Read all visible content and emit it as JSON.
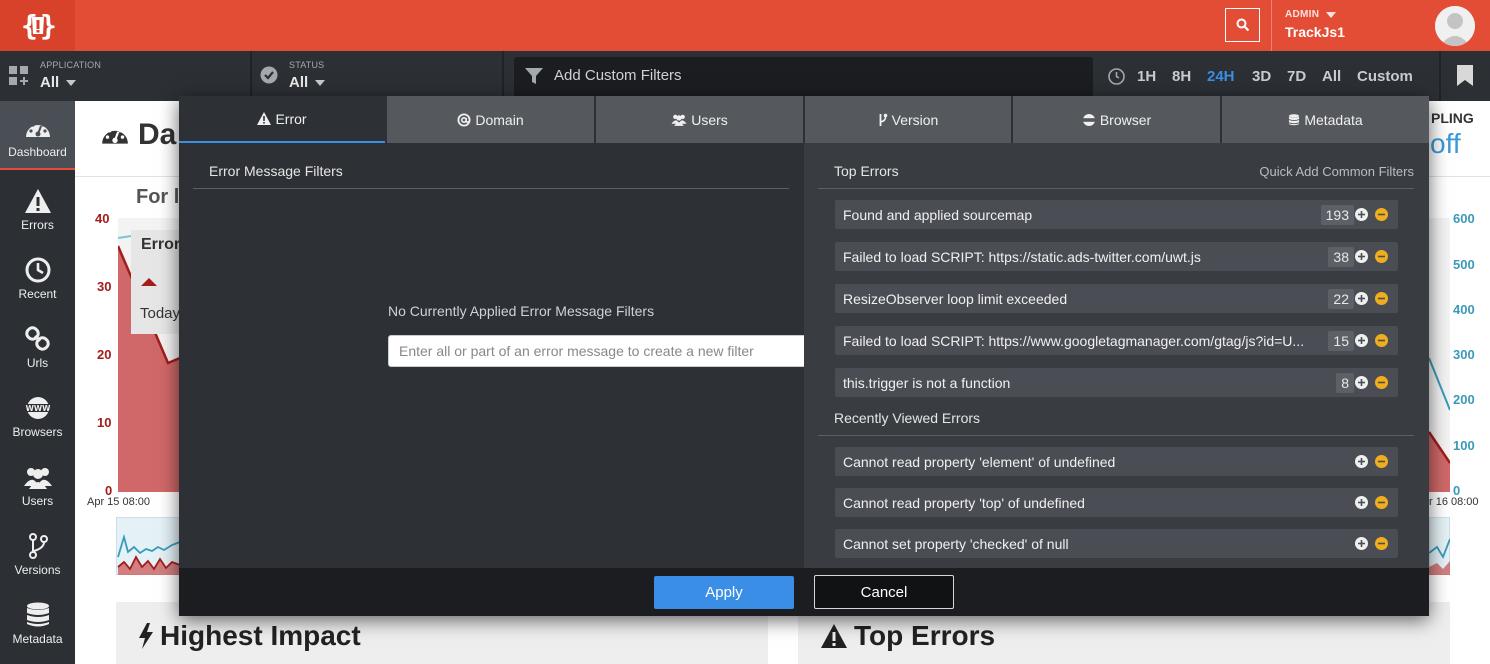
{
  "topbar": {
    "logo_text": "{!}",
    "admin_label": "ADMIN",
    "user_name": "TrackJs1"
  },
  "subbar": {
    "application_label": "APPLICATION",
    "application_value": "All",
    "status_label": "STATUS",
    "status_value": "All",
    "filter_text": "Add Custom Filters",
    "time_ranges": [
      "1H",
      "8H",
      "24H",
      "3D",
      "7D",
      "All",
      "Custom"
    ],
    "active_time_range": "24H"
  },
  "sidebar": {
    "items": [
      {
        "label": "Dashboard",
        "icon": "dashboard-gauge-icon"
      },
      {
        "label": "Errors",
        "icon": "warning-triangle-icon"
      },
      {
        "label": "Recent",
        "icon": "clock-icon"
      },
      {
        "label": "Urls",
        "icon": "link-icon"
      },
      {
        "label": "Browsers",
        "icon": "globe-www-icon"
      },
      {
        "label": "Users",
        "icon": "users-icon"
      },
      {
        "label": "Versions",
        "icon": "branch-icon"
      },
      {
        "label": "Metadata",
        "icon": "database-icon"
      }
    ]
  },
  "background": {
    "page_title": "Da",
    "subtitle": "For l",
    "sampling": "PLING",
    "sampling_value": "off",
    "card_title": "Error",
    "card_today": "Today",
    "left_axis": [
      "40",
      "30",
      "20",
      "10",
      "0"
    ],
    "right_axis": [
      "600",
      "500",
      "400",
      "300",
      "200",
      "100",
      "0"
    ],
    "x_start": "Apr 15 08:00",
    "x_end": "r 16 08:00",
    "highest_impact": "Highest Impact",
    "top_errors": "Top Errors",
    "colors": {
      "red_series": "#b3181b",
      "blue_series": "#3a9ab9"
    }
  },
  "modal": {
    "tabs": [
      {
        "label": "Error",
        "icon": "warning-icon"
      },
      {
        "label": "Domain",
        "icon": "at-icon"
      },
      {
        "label": "Users",
        "icon": "users-icon"
      },
      {
        "label": "Version",
        "icon": "branch-icon"
      },
      {
        "label": "Browser",
        "icon": "browser-icon"
      },
      {
        "label": "Metadata",
        "icon": "database-icon"
      }
    ],
    "left": {
      "title": "Error Message Filters",
      "empty_text": "No Currently Applied Error Message Filters",
      "input_placeholder": "Enter all or part of an error message to create a new filter"
    },
    "right": {
      "top_errors_title": "Top Errors",
      "quick_add": "Quick Add Common Filters",
      "top_errors": [
        {
          "message": "Found and applied sourcemap",
          "count": "193"
        },
        {
          "message": "Failed to load SCRIPT: https://static.ads-twitter.com/uwt.js",
          "count": "38"
        },
        {
          "message": "ResizeObserver loop limit exceeded",
          "count": "22"
        },
        {
          "message": "Failed to load SCRIPT: https://www.googletagmanager.com/gtag/js?id=U...",
          "count": "15"
        },
        {
          "message": "this.trigger is not a function",
          "count": "8"
        }
      ],
      "recent_title": "Recently Viewed Errors",
      "recent_errors": [
        {
          "message": "Cannot read property 'element' of undefined"
        },
        {
          "message": "Cannot read property 'top' of undefined"
        },
        {
          "message": "Cannot set property 'checked' of null"
        }
      ]
    },
    "footer": {
      "apply_label": "Apply",
      "cancel_label": "Cancel"
    }
  },
  "colors": {
    "brand": "#e34d35",
    "accent": "#3a8ee6",
    "minus": "#f0ad1e"
  }
}
